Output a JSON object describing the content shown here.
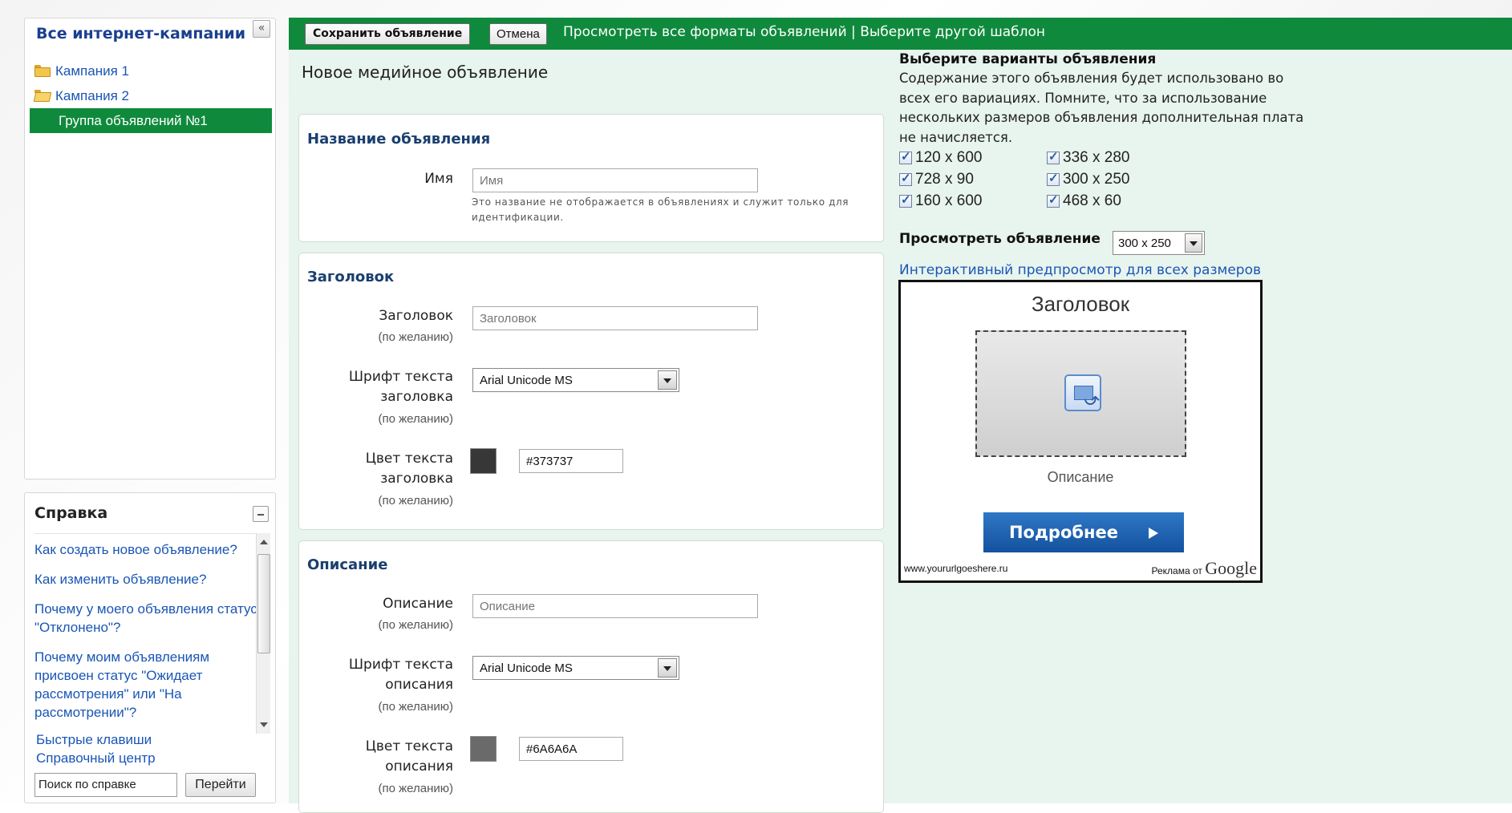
{
  "sidebar": {
    "title": "Все интернет-кампании",
    "collapse": "«",
    "items": [
      {
        "label": "Кампания 1",
        "icon": "folder-icon"
      },
      {
        "label": "Кампания 2",
        "icon": "folder-open-icon"
      },
      {
        "label": "Группа объявлений №1",
        "selected": true
      }
    ]
  },
  "help": {
    "title": "Справка",
    "links": [
      "Как создать новое объявление?",
      "Как изменить объявление?",
      "Почему у моего объявления статус \"Отклонено\"?",
      "Почему моим объявлениям присвоен статус \"Ожидает рассмотрения\" или \"На рассмотрении\"?"
    ],
    "shortcuts": "Быстрые клавиши",
    "help_center": "Справочный центр",
    "search_value": "Поиск по справке",
    "go_label": "Перейти"
  },
  "toolbar": {
    "save_label": "Сохранить объявление",
    "cancel_label": "Отмена",
    "view_all_formats": "Просмотреть все форматы объявлений",
    "separator": " | ",
    "choose_template": "Выберите другой шаблон",
    "bg_color": "#0f8a3c"
  },
  "page": {
    "title": "Новое медийное объявление"
  },
  "name_panel": {
    "title": "Название объявления",
    "label": "Имя",
    "placeholder": "Имя",
    "hint": "Это название не отображается в объявлениях и служит только для идентификации."
  },
  "headline_panel": {
    "title": "Заголовок",
    "headline_label": "Заголовок",
    "headline_placeholder": "Заголовок",
    "optional": "(по желанию)",
    "font_label": "Шрифт текста заголовка",
    "font_value": "Arial Unicode MS",
    "color_label": "Цвет текста заголовка",
    "color_value": "#373737"
  },
  "description_panel": {
    "title": "Описание",
    "desc_label": "Описание",
    "desc_placeholder": "Описание",
    "optional": "(по желанию)",
    "font_label": "Шрифт текста описания",
    "font_value": "Arial Unicode MS",
    "color_label": "Цвет текста описания",
    "color_value": "#6A6A6A"
  },
  "variants": {
    "title": "Выберите варианты объявления",
    "description": "Содержание этого объявления будет использовано во всех его вариациях. Помните, что за использование нескольких размеров объявления дополнительная плата не начисляется.",
    "sizes": [
      {
        "label": "120 x 600",
        "checked": true
      },
      {
        "label": "336 x 280",
        "checked": true
      },
      {
        "label": "728 x 90",
        "checked": true
      },
      {
        "label": "300 x 250",
        "checked": true
      },
      {
        "label": "160 x 600",
        "checked": true
      },
      {
        "label": "468 x 60",
        "checked": true
      }
    ]
  },
  "preview": {
    "label": "Просмотреть объявление",
    "size_value": "300 x 250",
    "interactive_link": "Интерактивный предпросмотр для всех размеров",
    "ad": {
      "title": "Заголовок",
      "description": "Описание",
      "button": "Подробнее",
      "url": "www.yoururlgoeshere.ru",
      "ads_by": "Реклама от",
      "google": "Google"
    }
  }
}
